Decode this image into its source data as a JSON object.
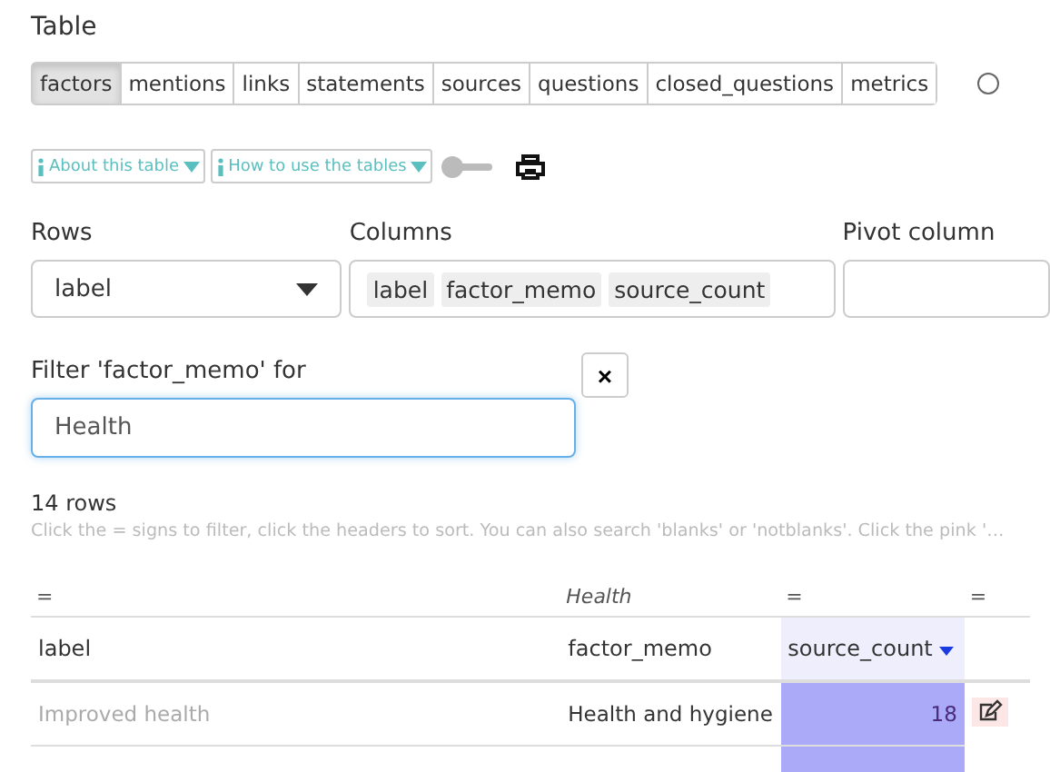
{
  "heading": "Table",
  "tabs": [
    {
      "label": "factors",
      "selected": true
    },
    {
      "label": "mentions",
      "selected": false
    },
    {
      "label": "links",
      "selected": false
    },
    {
      "label": "statements",
      "selected": false
    },
    {
      "label": "sources",
      "selected": false
    },
    {
      "label": "questions",
      "selected": false
    },
    {
      "label": "closed_questions",
      "selected": false
    },
    {
      "label": "metrics",
      "selected": false
    }
  ],
  "radio": {
    "selected": false
  },
  "info_buttons": [
    "About this table",
    "How to use the tables"
  ],
  "toggle": {
    "on": false
  },
  "rows_field": {
    "label": "Rows",
    "value": "label"
  },
  "columns_field": {
    "label": "Columns",
    "chips": [
      "label",
      "factor_memo",
      "source_count"
    ]
  },
  "pivot_field": {
    "label": "Pivot column"
  },
  "filter": {
    "label": "Filter 'factor_memo' for",
    "value": "Health",
    "clear": "×"
  },
  "row_count": "14 rows",
  "hint": "Click the = signs to filter, click the headers to sort. You can also search 'blanks' or 'notblanks'. Click the pink '…",
  "table": {
    "filters": [
      "=",
      "Health",
      "=",
      "="
    ],
    "columns": [
      {
        "label": "label",
        "sorted": false
      },
      {
        "label": "factor_memo",
        "sorted": false
      },
      {
        "label": "source_count",
        "sorted": true
      }
    ],
    "rows": [
      {
        "label": "Improved health",
        "muted": true,
        "factor_memo": "Health and hygiene",
        "source_count": "18"
      }
    ]
  }
}
